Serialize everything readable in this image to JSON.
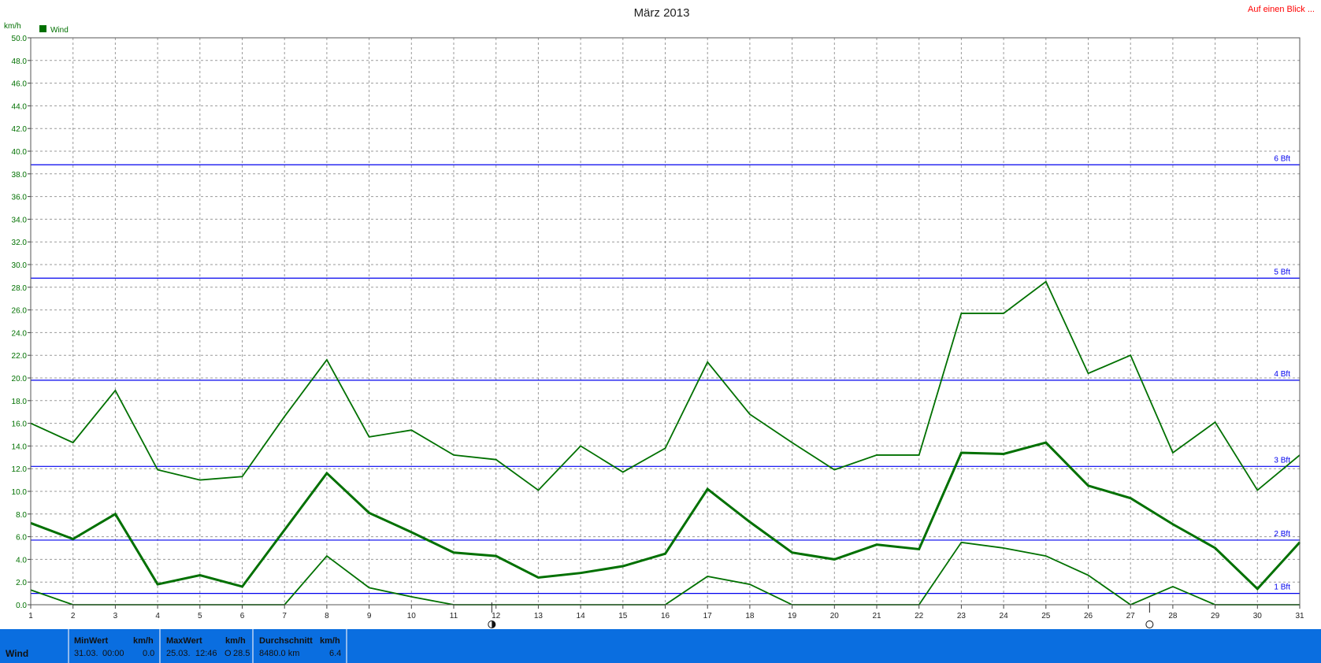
{
  "top_link": "Auf einen Blick ...",
  "chart_data": {
    "type": "line",
    "title": "März 2013",
    "ylabel": "km/h",
    "ylim": [
      0,
      50
    ],
    "y_ticks": [
      "0.0",
      "2.0",
      "4.0",
      "6.0",
      "8.0",
      "10.0",
      "12.0",
      "14.0",
      "16.0",
      "18.0",
      "20.0",
      "22.0",
      "24.0",
      "26.0",
      "28.0",
      "30.0",
      "32.0",
      "34.0",
      "36.0",
      "38.0",
      "40.0",
      "42.0",
      "44.0",
      "46.0",
      "48.0",
      "50.0"
    ],
    "x": [
      1,
      2,
      3,
      4,
      5,
      6,
      7,
      8,
      9,
      10,
      11,
      12,
      13,
      14,
      15,
      16,
      17,
      18,
      19,
      20,
      21,
      22,
      23,
      24,
      25,
      26,
      27,
      28,
      29,
      30,
      31
    ],
    "grid": true,
    "legend": {
      "position": "top-left",
      "entries": [
        {
          "label": "Wind",
          "color": "#007000"
        }
      ]
    },
    "series": [
      {
        "role": "max",
        "color": "#007000",
        "values": [
          16.0,
          14.3,
          18.9,
          11.9,
          11.0,
          11.3,
          16.6,
          21.6,
          14.8,
          15.4,
          13.2,
          12.8,
          10.1,
          14.0,
          11.7,
          13.8,
          21.4,
          16.8,
          14.3,
          11.9,
          13.2,
          13.2,
          25.7,
          25.7,
          28.5,
          20.4,
          22.0,
          13.4,
          16.1,
          10.1,
          13.2
        ]
      },
      {
        "role": "average",
        "color": "#007000",
        "values": [
          7.2,
          5.8,
          8.0,
          1.8,
          2.6,
          1.6,
          6.6,
          11.6,
          8.1,
          6.4,
          4.6,
          4.3,
          2.4,
          2.8,
          3.4,
          4.5,
          10.2,
          7.3,
          4.6,
          4.0,
          5.3,
          4.9,
          13.4,
          13.3,
          14.3,
          10.5,
          9.4,
          7.1,
          5.0,
          1.4,
          5.5
        ]
      },
      {
        "role": "min",
        "color": "#007000",
        "values": [
          1.3,
          0.0,
          0.0,
          0.0,
          0.0,
          0.0,
          0.0,
          4.3,
          1.5,
          0.7,
          0.0,
          0.0,
          0.0,
          0.0,
          0.0,
          0.0,
          2.5,
          1.8,
          0.0,
          0.0,
          0.0,
          0.0,
          5.5,
          5.0,
          4.3,
          2.6,
          0.0,
          1.6,
          0.0,
          0.0,
          0.0
        ]
      }
    ],
    "beaufort_lines": [
      {
        "label": "1 Bft",
        "value": 1.0
      },
      {
        "label": "2 Bft",
        "value": 5.7
      },
      {
        "label": "3 Bft",
        "value": 12.2
      },
      {
        "label": "4 Bft",
        "value": 19.8
      },
      {
        "label": "5 Bft",
        "value": 28.8
      },
      {
        "label": "6 Bft",
        "value": 38.8
      }
    ],
    "moon_markers": [
      {
        "phase": "half",
        "x": 11.9
      },
      {
        "phase": "full",
        "x": 27.45
      }
    ]
  },
  "footer": {
    "name": "Wind",
    "min": {
      "header": "MinWert",
      "unit": "km/h",
      "date": "31.03.",
      "time": "00:00",
      "value": "0.0"
    },
    "max": {
      "header": "MaxWert",
      "unit": "km/h",
      "date": "25.03.",
      "time": "12:46",
      "dir": "O",
      "value": "28.5"
    },
    "avg": {
      "header": "Durchschnitt",
      "unit": "km/h",
      "distance": "8480.0 km",
      "value": "6.4"
    }
  },
  "colors": {
    "series": "#007000",
    "beaufort": "#0000ee",
    "footer_bg": "#0a6ee0",
    "link": "#ff0000"
  }
}
